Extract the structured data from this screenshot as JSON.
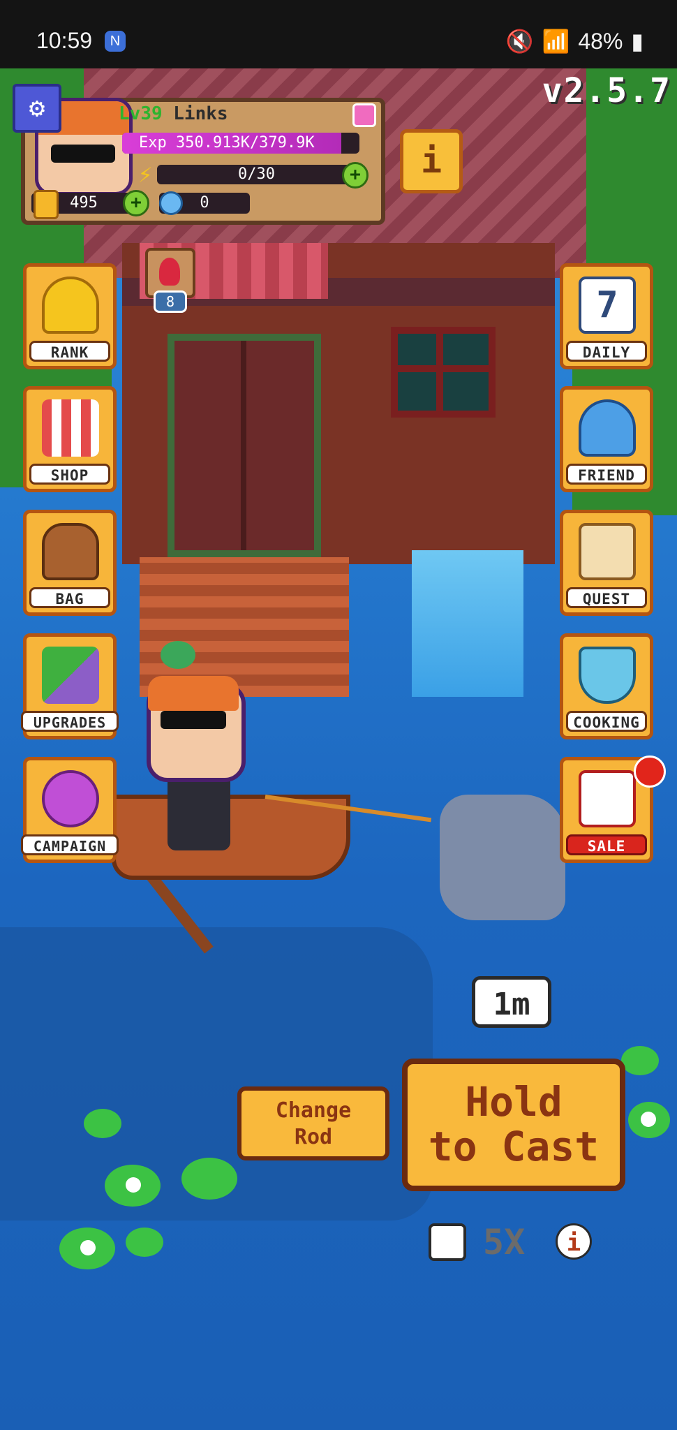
{
  "status_bar": {
    "time": "10:59",
    "notification_icon": "n-icon",
    "battery": "48%"
  },
  "game": {
    "version": "v2.5.7",
    "player": {
      "level_prefix": "Lv",
      "level": "39",
      "name": "Links",
      "exp_text": "Exp 350.913K/379.9K",
      "exp_fraction": 0.924,
      "energy_text": "0/30",
      "coins": "495",
      "gems": "0"
    },
    "info_label": "i",
    "fish_count": "8",
    "left_menu": [
      {
        "id": "rank",
        "label": "RANK",
        "icon": "trophy-icon"
      },
      {
        "id": "shop",
        "label": "SHOP",
        "icon": "shop-icon"
      },
      {
        "id": "bag",
        "label": "BAG",
        "icon": "backpack-icon"
      },
      {
        "id": "upgrades",
        "label": "UPGRADES",
        "icon": "upgrade-arrow-icon"
      },
      {
        "id": "campaign",
        "label": "CAMPAIGN",
        "icon": "balloon-icon"
      }
    ],
    "right_menu": [
      {
        "id": "daily",
        "label": "DAILY",
        "icon": "calendar-icon",
        "day": "7"
      },
      {
        "id": "friend",
        "label": "FRIEND",
        "icon": "add-friend-icon"
      },
      {
        "id": "quest",
        "label": "QUEST",
        "icon": "scroll-icon"
      },
      {
        "id": "cooking",
        "label": "COOKING",
        "icon": "cooking-pot-icon"
      },
      {
        "id": "sale",
        "label": "SALE",
        "icon": "megaphone-icon"
      }
    ],
    "distance": "1m",
    "change_rod_line1": "Change",
    "change_rod_line2": "Rod",
    "cast_line1": "Hold",
    "cast_line2": "to Cast",
    "multiplier": "5X",
    "multiplier_info": "i"
  }
}
